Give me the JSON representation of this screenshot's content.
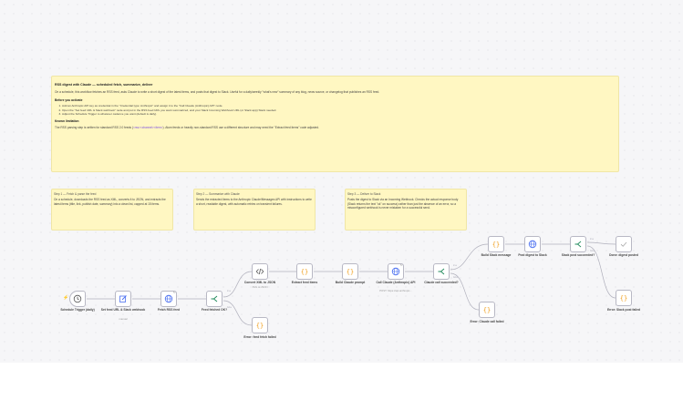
{
  "notes": {
    "main": {
      "title": "RSS digest with Claude — scheduled fetch, summarize, deliver",
      "intro": "On a schedule, this workflow fetches an RSS feed, asks Claude to write a short digest of the latest items, and posts that digest to Slack. Useful for a daily/weekly \"what's new\" summary of any blog, news source, or changelog that publishes an RSS feed.",
      "before_heading": "Before you activate",
      "steps": [
        "Add an Anthropic API key as credential in the \"Credential type: Anthropic\" and assign it to the \"Call Claude (Anthropic) API\" node.",
        "Open the \"Set feed URL & Slack webhook\" node and put in the RSS feed URL you want summarized, and your Slack Incoming Webhook URL (or Slack app) Slack needed.",
        "Adjust the Schedule Trigger to whatever cadence you want (default is daily)."
      ],
      "limits_heading": "Known limitation",
      "limits_pre": "The RSS parsing step is written for standard RSS 2.0 feeds (",
      "limits_code": "<rss><channel><item>",
      "limits_post": "). Atom feeds or heavily non-standard RSS use a different structure and may need the \"Extract feed items\" code adjusted."
    },
    "step1": {
      "title": "Step 1 — Fetch & parse the feed",
      "body": "On a schedule, downloads the RSS feed as XML, converts it to JSON, and extracts the latest items (title, link, publish date, summary) into a clean list, capped at 15 items."
    },
    "step2": {
      "title": "Step 2 — Summarize with Claude",
      "body": "Sends the extracted items to the Anthropic Claude/Messages API with instructions to write a short, readable digest, with automatic retries on transient failures."
    },
    "step3": {
      "title": "Step 3 — Deliver to Slack",
      "body": "Posts the digest to Slack via an Incoming Webhook. Checks the actual response body (Slack returns the text \"ok\" on success) rather than just the absence of an error, so a misconfigured webhook is never mistaken for a successful send."
    }
  },
  "nodes": {
    "schedule": {
      "label": "Schedule Trigger (daily)",
      "icon": "clock-icon"
    },
    "setfeed": {
      "label": "Set feed URL & Slack webhook",
      "sub": "manual",
      "icon": "edit-icon"
    },
    "fetch": {
      "label": "Fetch RSS feed",
      "icon": "globe-icon"
    },
    "fetched": {
      "label": "Feed fetched OK?",
      "icon": "branch-icon"
    },
    "convert": {
      "label": "Convert XML to JSON",
      "sub": "XML to JSON",
      "icon": "code-icon"
    },
    "extract": {
      "label": "Extract feed items",
      "icon": "braces-icon"
    },
    "prompt": {
      "label": "Build Claude prompt",
      "icon": "braces-icon"
    },
    "callclaude": {
      "label": "Call Claude (Anthropic) API",
      "sub": "POST: https://api.anthropic...",
      "icon": "globe-icon"
    },
    "claudeok": {
      "label": "Claude call succeeded?",
      "icon": "branch-icon"
    },
    "feederr": {
      "label": "Error: feed fetch failed",
      "icon": "braces-icon"
    },
    "slackmsg": {
      "label": "Build Slack message",
      "icon": "braces-icon"
    },
    "post": {
      "label": "Post digest to Slack",
      "icon": "globe-icon"
    },
    "slackok": {
      "label": "Slack post succeeded?",
      "icon": "branch-icon"
    },
    "done": {
      "label": "Done: digest posted",
      "icon": "check-icon"
    },
    "claudeerr": {
      "label": "Error: Claude call failed",
      "icon": "braces-icon"
    },
    "slackerr": {
      "label": "Error: Slack post failed",
      "icon": "braces-icon"
    }
  },
  "colors": {
    "accent": "#ff6d5a",
    "node_border": "#b8b8c4",
    "note_bg": "#fff7c2",
    "wire": "#b0b0bc",
    "trigger": "#ff6d5a",
    "set": "#4a6ff0",
    "http": "#4a6ff0",
    "if": "#1f8a5b",
    "code": "#f0a020"
  }
}
